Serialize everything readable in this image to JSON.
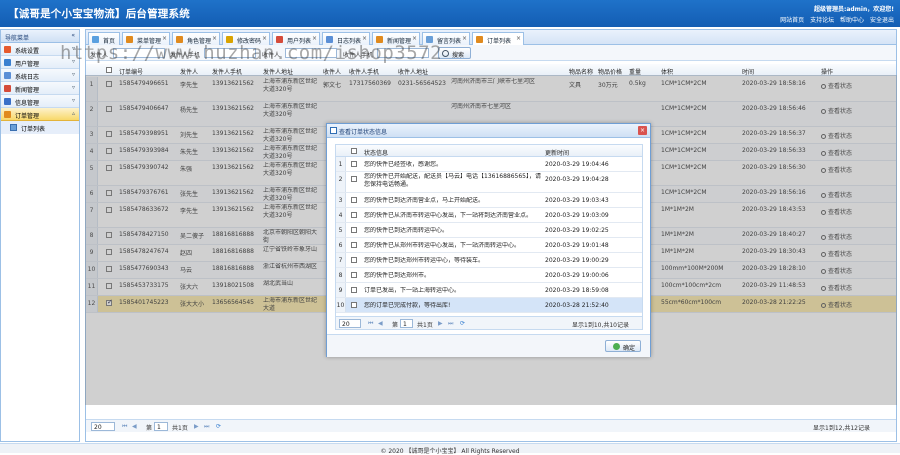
{
  "header": {
    "title": "【诚哥是个小宝宝物流】后台管理系统",
    "welcome": "超级管理员:admin，欢迎您!",
    "links": [
      "网站首页",
      "支持论坛",
      "帮助中心",
      "安全退出"
    ]
  },
  "sidebar": {
    "title": "导航菜单",
    "items": [
      "系统设置",
      "用户管理",
      "系统日志",
      "新闻管理",
      "信息管理",
      "订单管理"
    ],
    "subitem": "订单列表"
  },
  "tabs": [
    "首页",
    "菜单管理",
    "角色管理",
    "修改密码",
    "用户列表",
    "日志列表",
    "新闻管理",
    "留言列表",
    "订单列表"
  ],
  "search": {
    "labels": [
      "发件人",
      "发件人手机",
      "收件人",
      "收件人手机"
    ],
    "button": "搜索"
  },
  "grid": {
    "columns": [
      "订单编号",
      "发件人",
      "发件人手机",
      "发件人地址",
      "收件人",
      "收件人手机",
      "收件人地址",
      "物品名称",
      "物品价格",
      "重量",
      "体积",
      "时间",
      "操作"
    ],
    "rows": [
      {
        "no": "1",
        "id": "1585479496651",
        "sender": "李先生",
        "sphone": "13913621562",
        "saddr": "上海市浦东新区世纪大道320号",
        "rec": "郭文七",
        "rphone": "17317560369",
        "rtel": "0231-56564523",
        "raddr": "河南州济南市三门峡市七里河区",
        "item": "文具",
        "price": "30万元",
        "weight": "0.5kg",
        "vol": "1CM*1CM*2CM",
        "time": "2020-03-29 18:58:16",
        "action": "查看状态"
      },
      {
        "no": "2",
        "id": "1585479406647",
        "sender": "杨先生",
        "sphone": "13913621562",
        "saddr": "上海市浦东新区世纪大道320号",
        "rec": "",
        "rphone": "",
        "rtel": "",
        "raddr": "河南州济南市七里河区",
        "item": "",
        "price": "",
        "weight": "",
        "vol": "1CM*1CM*2CM",
        "time": "2020-03-29 18:56:46",
        "action": "查看状态"
      },
      {
        "no": "3",
        "id": "1585479398951",
        "sender": "刘先生",
        "sphone": "13913621562",
        "saddr": "上海市浦东新区世纪大道320号",
        "rec": "",
        "rphone": "",
        "rtel": "",
        "raddr": "",
        "item": "",
        "price": "",
        "weight": "",
        "vol": "1CM*1CM*2CM",
        "time": "2020-03-29 18:56:37",
        "action": "查看状态"
      },
      {
        "no": "4",
        "id": "1585479393984",
        "sender": "朱先生",
        "sphone": "13913621562",
        "saddr": "上海市浦东新区世纪大道320号",
        "rec": "",
        "rphone": "",
        "rtel": "",
        "raddr": "",
        "item": "",
        "price": "",
        "weight": "",
        "vol": "1CM*1CM*2CM",
        "time": "2020-03-29 18:56:33",
        "action": "查看状态"
      },
      {
        "no": "5",
        "id": "1585479390742",
        "sender": "朱强",
        "sphone": "13913621562",
        "saddr": "上海市浦东新区世纪大道320号",
        "rec": "",
        "rphone": "",
        "rtel": "",
        "raddr": "",
        "item": "",
        "price": "",
        "weight": "",
        "vol": "1CM*1CM*2CM",
        "time": "2020-03-29 18:56:30",
        "action": "查看状态"
      },
      {
        "no": "6",
        "id": "1585479376761",
        "sender": "张先生",
        "sphone": "13913621562",
        "saddr": "上海市浦东新区世纪大道320号",
        "rec": "",
        "rphone": "",
        "rtel": "",
        "raddr": "",
        "item": "",
        "price": "",
        "weight": "",
        "vol": "1CM*1CM*2CM",
        "time": "2020-03-29 18:56:16",
        "action": "查看状态"
      },
      {
        "no": "7",
        "id": "1585478633672",
        "sender": "李先生",
        "sphone": "13913621562",
        "saddr": "上海市浦东新区世纪大道320号",
        "rec": "",
        "rphone": "",
        "rtel": "",
        "raddr": "",
        "item": "",
        "price": "",
        "weight": "",
        "vol": "1M*1M*2M",
        "time": "2020-03-29 18:43:53",
        "action": "查看状态"
      },
      {
        "no": "8",
        "id": "1585478427150",
        "sender": "吴二傻子",
        "sphone": "18816816888",
        "saddr": "北京市朝阳区朝阳大街",
        "rec": "",
        "rphone": "",
        "rtel": "",
        "raddr": "",
        "item": "",
        "price": "",
        "weight": "",
        "vol": "1M*1M*2M",
        "time": "2020-03-29 18:40:27",
        "action": "查看状态"
      },
      {
        "no": "9",
        "id": "1585478247674",
        "sender": "赵四",
        "sphone": "18816816888",
        "saddr": "辽宁省铁岭市象牙山",
        "rec": "",
        "rphone": "",
        "rtel": "",
        "raddr": "",
        "item": "",
        "price": "",
        "weight": "",
        "vol": "1M*1M*2M",
        "time": "2020-03-29 18:30:43",
        "action": "查看状态"
      },
      {
        "no": "10",
        "id": "1585477690343",
        "sender": "马云",
        "sphone": "18816816888",
        "saddr": "浙江省杭州市西湖区",
        "rec": "",
        "rphone": "",
        "rtel": "",
        "raddr": "",
        "item": "",
        "price": "",
        "weight": "",
        "vol": "100mm*100M*200M",
        "time": "2020-03-29 18:28:10",
        "action": "查看状态"
      },
      {
        "no": "11",
        "id": "1585453733175",
        "sender": "张大六",
        "sphone": "13918021508",
        "saddr": "湖北武当山",
        "rec": "",
        "rphone": "",
        "rtel": "",
        "raddr": "",
        "item": "",
        "price": "",
        "weight": "",
        "vol": "100cm*100cm*2cm",
        "time": "2020-03-29 11:48:53",
        "action": "查看状态"
      },
      {
        "no": "12",
        "id": "1585401745223",
        "sender": "张大大小",
        "sphone": "13656564545",
        "saddr": "上海市浦东新区世纪大道",
        "rec": "",
        "rphone": "",
        "rtel": "",
        "raddr": "",
        "item": "",
        "price": "",
        "weight": "",
        "vol": "55cm*60cm*100cm",
        "time": "2020-03-28 21:22:25",
        "action": "查看状态"
      }
    ]
  },
  "pager": {
    "size": "20",
    "page": "1",
    "of": "共1页",
    "summary": "显示1到12,共12记录"
  },
  "dialog": {
    "title": "查看订单状态信息",
    "columns": [
      "状态信息",
      "更新时间"
    ],
    "rows": [
      {
        "no": "1",
        "info": "您的快件已经签收，感谢您。",
        "time": "2020-03-29 19:04:46"
      },
      {
        "no": "2",
        "info": "您的快件已开始配送，配送员【马云】电话【13616886565】，请您保持电话畅通。",
        "time": "2020-03-29 19:04:28"
      },
      {
        "no": "3",
        "info": "您的快件已到达济南营业点，马上开始配送。",
        "time": "2020-03-29 19:03:43"
      },
      {
        "no": "4",
        "info": "您的快件已从济南市转运中心发出，下一站将到达济南营业点。",
        "time": "2020-03-29 19:03:09"
      },
      {
        "no": "5",
        "info": "您的快件已到达济南转运中心。",
        "time": "2020-03-29 19:02:25"
      },
      {
        "no": "6",
        "info": "您的快件已从郑州市转运中心发出，下一站济南转运中心。",
        "time": "2020-03-29 19:01:48"
      },
      {
        "no": "7",
        "info": "您的快件已到达郑州市转运中心，等待装车。",
        "time": "2020-03-29 19:00:29"
      },
      {
        "no": "8",
        "info": "您的快件已到达郑州市。",
        "time": "2020-03-29 19:00:06"
      },
      {
        "no": "9",
        "info": "订单已发出，下一站上海转运中心。",
        "time": "2020-03-29 18:59:08"
      },
      {
        "no": "10",
        "info": "您的订单已完成付款，等待出库!",
        "time": "2020-03-28 21:52:40"
      }
    ],
    "pager": {
      "size": "20",
      "page": "1",
      "of": "共1页",
      "summary": "显示1到10,共10记录"
    },
    "ok": "确定"
  },
  "footer": "© 2020 【诚哥是个小宝宝】 All Rights Reserved",
  "watermark": "https://www.huzhan.com/ishop3572",
  "colors": {
    "header": "#1a66bd",
    "accent": "#2f6db3",
    "selected": "#fbe9a6"
  }
}
